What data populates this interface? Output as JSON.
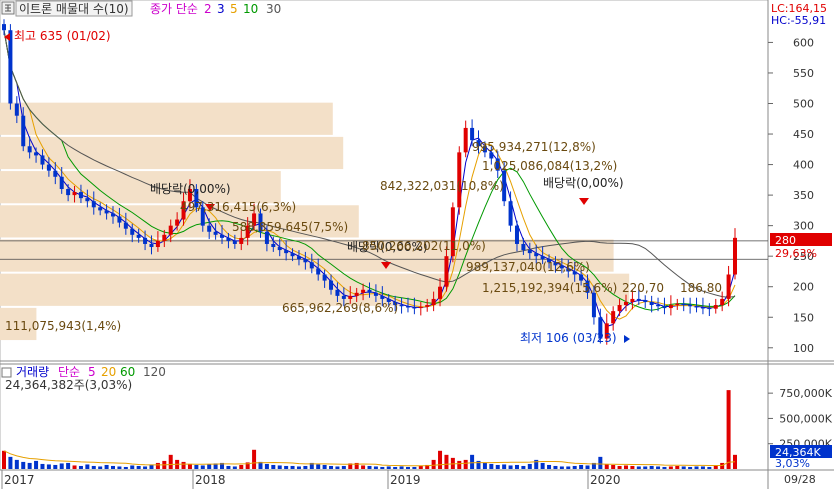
{
  "price_header": {
    "title": "이트론 매물대 수(10)",
    "ma_label": "종가 단순",
    "ma_periods": [
      "2",
      "3",
      "5",
      "10",
      "30"
    ],
    "ma_colors": [
      "#cc00cc",
      "#0000cc",
      "#e6a000",
      "#009900",
      "#555555"
    ],
    "lc": "LC:164,15",
    "hc": "HC:-55,91"
  },
  "volume_header": {
    "title": "거래량",
    "ma_label": "단순",
    "ma_periods": [
      "5",
      "20",
      "60",
      "120"
    ],
    "ma_colors": [
      "#cc00cc",
      "#e6a000",
      "#009900",
      "#555555"
    ],
    "current": "24,364,382주(3,03%)"
  },
  "bottom_right_label": "09/28",
  "current_price": {
    "value": "280",
    "change": "29,63%"
  },
  "current_volume": {
    "value": "24,364K",
    "change": "3,03%"
  },
  "icons": [
    "grid-icon"
  ],
  "chart_data": [
    {
      "type": "candlestick",
      "x_labels": [
        "2017",
        "2018",
        "2019",
        "2020"
      ],
      "y_ticks": [
        100,
        150,
        200,
        250,
        300,
        350,
        400,
        450,
        500,
        550,
        600
      ],
      "ylim": [
        80,
        640
      ],
      "high": {
        "label": "최고 635 (01/02)",
        "value": 635,
        "date": "01/02"
      },
      "low": {
        "label": "최저 106 (03/23)",
        "value": 106,
        "date": "03/23"
      },
      "dividend_markers": [
        {
          "label": "배당락(0,00%)",
          "price": 295
        },
        {
          "label": "배당락(0,00%)",
          "price": 215
        },
        {
          "label": "배당락(0,00%)",
          "price": 300
        }
      ],
      "volume_profile": [
        {
          "label": "111,075,943(1,4%)",
          "price_low": 111,
          "price_high": 167,
          "width_pct": 1.4
        },
        {
          "label": "665,962,269(8,6%)",
          "price_low": 167,
          "price_high": 223,
          "width_pct": 8.6
        },
        {
          "label": "1,215,192,394(15,6%)",
          "price_low": 167,
          "price_high": 223,
          "width_pct": 15.6
        },
        {
          "label": "989,137,040(12,6%)",
          "price_low": 223,
          "price_high": 279,
          "width_pct": 12.6
        },
        {
          "label": "850,266,202(11,0%)",
          "price_low": 223,
          "price_high": 279,
          "width_pct": 11.0
        },
        {
          "label": "588,859,645(7,5%)",
          "price_low": 279,
          "price_high": 335,
          "width_pct": 7.5
        },
        {
          "label": "497,316,415(6,3%)",
          "price_low": 279,
          "price_high": 335,
          "width_pct": 6.3
        },
        {
          "label": "842,322,031(10,8%)",
          "price_low": 335,
          "price_high": 391,
          "width_pct": 10.8
        },
        {
          "label": "1,025,086,084(13,2%)",
          "price_low": 391,
          "price_high": 447,
          "width_pct": 13.2
        },
        {
          "label": "995,934,271(12,8%)",
          "price_low": 447,
          "price_high": 503,
          "width_pct": 12.8
        }
      ],
      "price_labels": [
        "220,70",
        "186,80"
      ],
      "guide_lines": [
        275,
        245
      ],
      "close_series": [
        620,
        500,
        480,
        430,
        420,
        415,
        400,
        390,
        380,
        360,
        350,
        355,
        345,
        340,
        330,
        325,
        320,
        315,
        305,
        295,
        285,
        280,
        270,
        265,
        275,
        285,
        300,
        310,
        340,
        360,
        330,
        300,
        290,
        285,
        280,
        275,
        270,
        280,
        300,
        320,
        290,
        270,
        265,
        260,
        255,
        250,
        245,
        240,
        230,
        220,
        210,
        195,
        185,
        180,
        185,
        190,
        195,
        190,
        185,
        180,
        175,
        170,
        168,
        166,
        165,
        167,
        170,
        180,
        200,
        250,
        330,
        420,
        460,
        440,
        430,
        420,
        410,
        390,
        340,
        300,
        270,
        260,
        255,
        250,
        245,
        240,
        235,
        230,
        225,
        220,
        210,
        190,
        150,
        115,
        140,
        160,
        170,
        175,
        180,
        178,
        175,
        170,
        168,
        165,
        170,
        172,
        170,
        168,
        166,
        165,
        164,
        170,
        180,
        220,
        280
      ]
    },
    {
      "type": "bar",
      "series": [
        {
          "name": "거래량"
        }
      ],
      "y_ticks": [
        "250,000K",
        "500,000K",
        "750,000K"
      ],
      "ylim": [
        0,
        880000
      ],
      "values": [
        180000,
        120000,
        90000,
        70000,
        60000,
        80000,
        50000,
        45000,
        40000,
        55000,
        60000,
        35000,
        30000,
        45000,
        30000,
        25000,
        40000,
        30000,
        25000,
        20000,
        35000,
        30000,
        25000,
        45000,
        60000,
        80000,
        140000,
        90000,
        70000,
        50000,
        40000,
        35000,
        45000,
        55000,
        60000,
        30000,
        25000,
        40000,
        65000,
        190000,
        70000,
        50000,
        40000,
        35000,
        30000,
        30000,
        25000,
        30000,
        60000,
        45000,
        40000,
        30000,
        25000,
        30000,
        55000,
        60000,
        35000,
        30000,
        25000,
        20000,
        25000,
        20000,
        25000,
        20000,
        20000,
        30000,
        40000,
        90000,
        180000,
        140000,
        110000,
        80000,
        90000,
        140000,
        80000,
        60000,
        50000,
        40000,
        45000,
        35000,
        40000,
        30000,
        50000,
        90000,
        60000,
        40000,
        30000,
        25000,
        25000,
        30000,
        40000,
        35000,
        60000,
        120000,
        50000,
        40000,
        30000,
        35000,
        30000,
        25000,
        25000,
        30000,
        25000,
        20000,
        25000,
        30000,
        25000,
        20000,
        25000,
        25000,
        20000,
        30000,
        60000,
        780000,
        140000
      ]
    }
  ]
}
